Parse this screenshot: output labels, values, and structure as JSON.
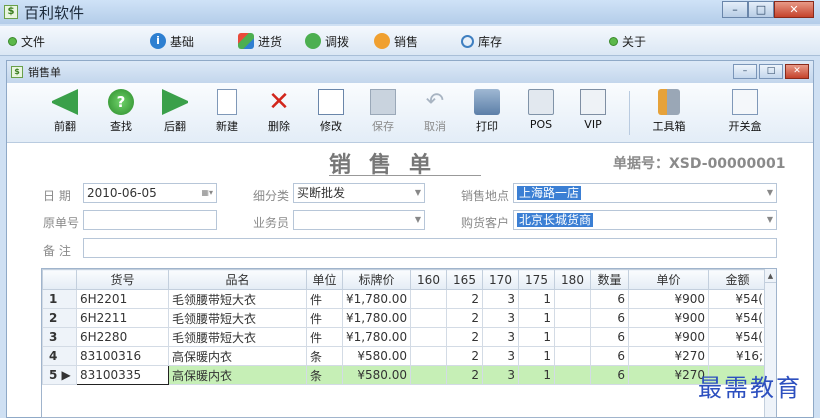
{
  "window": {
    "title": "百利软件",
    "min": "–",
    "max": "□",
    "close": "✕"
  },
  "menubar": {
    "items": [
      {
        "label": "文件",
        "icon": "dot-icon"
      },
      {
        "label": "基础",
        "icon": "info-icon"
      },
      {
        "label": "进货",
        "icon": "cubes-icon"
      },
      {
        "label": "调拨",
        "icon": "refresh-icon"
      },
      {
        "label": "销售",
        "icon": "people-icon"
      },
      {
        "label": "库存",
        "icon": "magnifier-icon"
      },
      {
        "label": "关于",
        "icon": "dot-icon"
      }
    ]
  },
  "child": {
    "title": "销售单",
    "min": "–",
    "max": "□",
    "close": "✕"
  },
  "toolbar": {
    "prev": "前翻",
    "find": "查找",
    "next": "后翻",
    "new": "新建",
    "delete": "删除",
    "edit": "修改",
    "save": "保存",
    "cancel": "取消",
    "print": "打印",
    "pos": "POS",
    "vip": "VIP",
    "tools": "工具箱",
    "cashbox": "开关盒",
    "find_glyph": "?",
    "delete_glyph": "✕",
    "undo_glyph": "↶"
  },
  "form": {
    "title": "销售单",
    "doc_no": "单据号：XSD-00000001",
    "date_label": "日 期",
    "date_value": "2010-06-05",
    "orig_no_label": "原单号",
    "orig_no_value": "",
    "note_label": "备 注",
    "note_value": "",
    "category_label": "细分类",
    "category_value": "买断批发",
    "clerk_label": "业务员",
    "clerk_value": "",
    "location_label": "销售地点",
    "location_value": "上海路一店",
    "customer_label": "购货客户",
    "customer_value": "北京长城货商"
  },
  "grid": {
    "columns": [
      "",
      "货号",
      "品名",
      "单位",
      "标牌价",
      "160",
      "165",
      "170",
      "175",
      "180",
      "数量",
      "单价",
      "金额"
    ],
    "rows": [
      {
        "no": "1",
        "code": "6H2201",
        "name": "毛领腰带短大衣",
        "unit": "件",
        "list_price": "¥1,780.00",
        "s160": "",
        "s165": "2",
        "s170": "3",
        "s175": "1",
        "s180": "",
        "qty": "6",
        "price": "¥900",
        "amount": "¥54("
      },
      {
        "no": "2",
        "code": "6H2211",
        "name": "毛领腰带短大衣",
        "unit": "件",
        "list_price": "¥1,780.00",
        "s160": "",
        "s165": "2",
        "s170": "3",
        "s175": "1",
        "s180": "",
        "qty": "6",
        "price": "¥900",
        "amount": "¥54("
      },
      {
        "no": "3",
        "code": "6H2280",
        "name": "毛领腰带短大衣",
        "unit": "件",
        "list_price": "¥1,780.00",
        "s160": "",
        "s165": "2",
        "s170": "3",
        "s175": "1",
        "s180": "",
        "qty": "6",
        "price": "¥900",
        "amount": "¥54("
      },
      {
        "no": "4",
        "code": "83100316",
        "name": "高保暖内衣",
        "unit": "条",
        "list_price": "¥580.00",
        "s160": "",
        "s165": "2",
        "s170": "3",
        "s175": "1",
        "s180": "",
        "qty": "6",
        "price": "¥270",
        "amount": "¥16;"
      },
      {
        "no": "5 ▶",
        "code": "83100335",
        "name": "高保暖内衣",
        "unit": "条",
        "list_price": "¥580.00",
        "s160": "",
        "s165": "2",
        "s170": "3",
        "s175": "1",
        "s180": "",
        "qty": "6",
        "price": "¥270",
        "amount": ""
      }
    ]
  },
  "watermark": "最需教育"
}
